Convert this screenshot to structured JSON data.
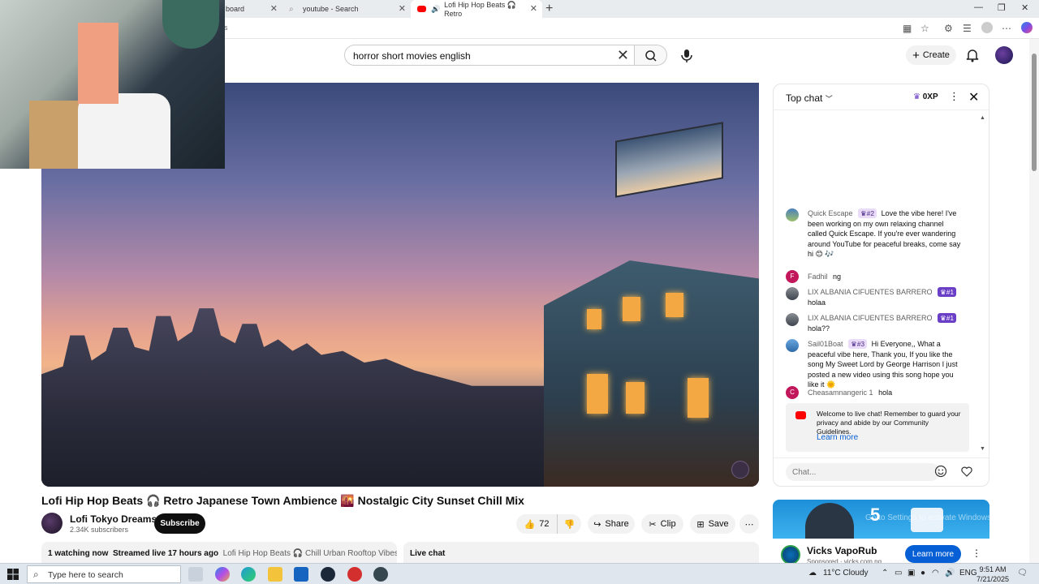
{
  "browser": {
    "tabs": [
      {
        "label": "board"
      },
      {
        "label": "youtube - Search"
      },
      {
        "label": "Lofi Hip Hop Beats 🎧 Retro"
      }
    ],
    "address": "s"
  },
  "masthead": {
    "search_value": "horror short movies english",
    "create_label": "Create"
  },
  "video": {
    "title": "Lofi Hip Hop Beats 🎧 Retro Japanese Town Ambience 🌇 Nostalgic City Sunset Chill Mix",
    "channel_name": "Lofi Tokyo Dreams",
    "subscribers": "2.34K subscribers",
    "subscribe_label": "Subscribe",
    "likes": "72",
    "share_label": "Share",
    "clip_label": "Clip",
    "save_label": "Save",
    "watching": "1 watching now",
    "streamed": "Streamed live 17 hours ago",
    "desc_snippet": "Lofi Hip Hop Beats 🎧 Chill Urban Rooftop Vibes & Ra",
    "live_chat_label": "Live chat"
  },
  "chat": {
    "title": "Top chat",
    "xp": "0XP",
    "messages": [
      {
        "author": "Quick Escape",
        "badge": "#2",
        "text": "Love the vibe here! I've been working on my own relaxing channel called Quick Escape. If you're ever wandering around YouTube for peaceful breaks, come say hi 😊 🎶"
      },
      {
        "author": "Fadhil",
        "avatar_letter": "F",
        "text": "ng"
      },
      {
        "author": "LIX ALBANIA CIFUENTES BARRERO",
        "badge": "#1",
        "text": "holaa"
      },
      {
        "author": "LIX ALBANIA CIFUENTES BARRERO",
        "badge": "#1",
        "text": "hola??"
      },
      {
        "author": "Sail01Boat",
        "badge": "#3",
        "text": "Hi Everyone,, What a peaceful vibe here, Thank you, If you like the song My Sweet Lord by George Harrison I just posted a new video using this song hope you like it 🌞"
      },
      {
        "author": "Cheasamnangeric 1",
        "avatar_letter": "C",
        "text": "hola"
      }
    ],
    "notice": "Welcome to live chat! Remember to guard your privacy and abide by our Community Guidelines.",
    "learn_more": "Learn more",
    "input_placeholder": "Chat..."
  },
  "ad": {
    "title": "Vicks VapoRub",
    "sponsored": "Sponsored · vicks.com.ng",
    "cta": "Learn more",
    "banner_number": "5",
    "watermark_line1": "Go to Settings to activate Windows."
  },
  "taskbar": {
    "search_placeholder": "Type here to search",
    "weather": "11°C  Cloudy",
    "lang": "ENG",
    "time": "9:51 AM",
    "date": "7/21/2025"
  },
  "colors": {
    "youtube_red": "#ff0000",
    "link_blue": "#065fd4",
    "badge_purple": "#6a3ec7"
  }
}
